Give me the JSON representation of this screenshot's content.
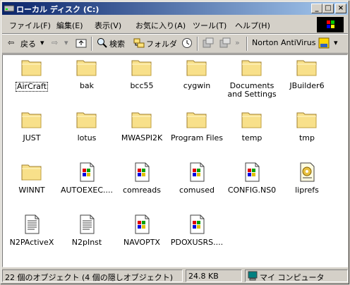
{
  "window": {
    "title": "ローカル ディスク (C:)"
  },
  "menu": {
    "file": "ファイル(F)",
    "edit": "編集(E)",
    "view": "表示(V)",
    "favorites": "お気に入り(A)",
    "tools": "ツール(T)",
    "help": "ヘルプ(H)"
  },
  "toolbar": {
    "back": "戻る",
    "search": "検索",
    "folders": "フォルダ",
    "norton": "Norton AntiVirus"
  },
  "items": [
    {
      "name": "AirCraft",
      "type": "folder"
    },
    {
      "name": "bak",
      "type": "folder"
    },
    {
      "name": "bcc55",
      "type": "folder"
    },
    {
      "name": "cygwin",
      "type": "folder"
    },
    {
      "name": "Documents\nand Settings",
      "type": "folder"
    },
    {
      "name": "JBuilder6",
      "type": "folder"
    },
    {
      "name": "JUST",
      "type": "folder"
    },
    {
      "name": "lotus",
      "type": "folder"
    },
    {
      "name": "MWASPI2K",
      "type": "folder"
    },
    {
      "name": "Program Files",
      "type": "folder"
    },
    {
      "name": "temp",
      "type": "folder"
    },
    {
      "name": "tmp",
      "type": "folder"
    },
    {
      "name": "WINNT",
      "type": "folder"
    },
    {
      "name": "AUTOEXEC....",
      "type": "winfile"
    },
    {
      "name": "comreads",
      "type": "winfile"
    },
    {
      "name": "comused",
      "type": "winfile"
    },
    {
      "name": "CONFIG.NS0",
      "type": "winfile"
    },
    {
      "name": "liprefs",
      "type": "settings"
    },
    {
      "name": "N2PActiveX",
      "type": "text"
    },
    {
      "name": "N2pInst",
      "type": "text"
    },
    {
      "name": "NAVOPTX",
      "type": "winfile"
    },
    {
      "name": "PDOXUSRS....",
      "type": "winfile"
    }
  ],
  "status": {
    "objects": "22 個のオブジェクト (4 個の隠しオブジェクト)",
    "size": "24.8 KB",
    "location": "マイ コンピュータ"
  }
}
